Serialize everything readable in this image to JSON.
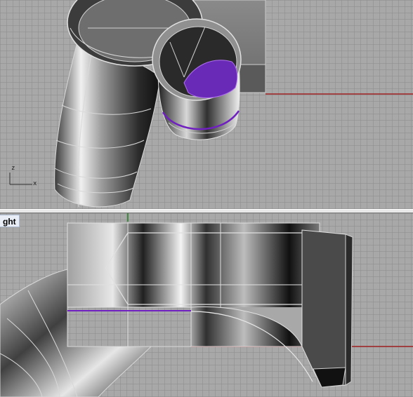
{
  "viewports": {
    "top": {
      "axis_x": "x",
      "axis_z": "z"
    },
    "bottom": {
      "title": "ght"
    }
  },
  "colors": {
    "grid_background": "#a8a8a8",
    "x_axis_line": "#a02020",
    "selection_edge": "#7020c0",
    "wireframe": "#e0e0e0",
    "title_tab": "#e9eef6"
  }
}
